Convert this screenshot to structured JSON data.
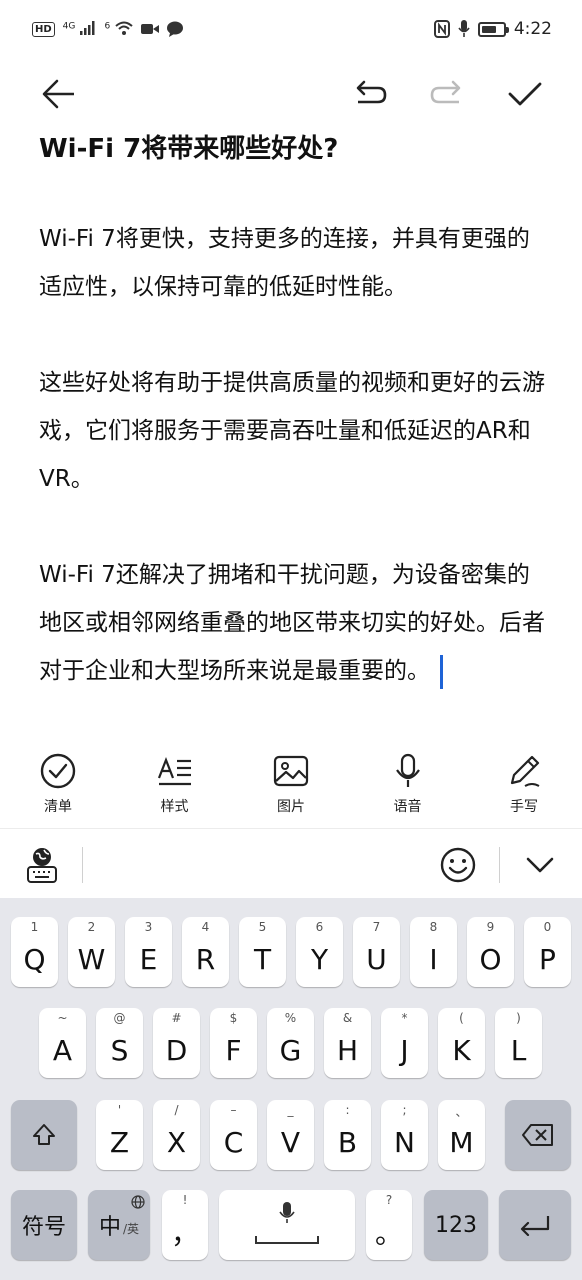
{
  "status_bar": {
    "hd": "HD",
    "sig1": "4G",
    "sig2": "6",
    "time": "4:22",
    "battery_level": 0.7
  },
  "toolbar": {
    "back_icon": "arrow-left-icon",
    "undo_icon": "undo-icon",
    "redo_icon": "redo-icon",
    "done_icon": "check-icon"
  },
  "note": {
    "title": "Wi-Fi 7将带来哪些好处?",
    "paragraphs": [
      "Wi-Fi 7将更快，支持更多的连接，并具有更强的适应性，以保持可靠的低延时性能。",
      "这些好处将有助于提供高质量的视频和更好的云游戏，它们将服务于需要高吞吐量和低延迟的AR和VR。",
      "Wi-Fi 7还解决了拥堵和干扰问题，为设备密集的地区或相邻网络重叠的地区带来切实的好处。后者对于企业和大型场所来说是最重要的。"
    ]
  },
  "format_bar": [
    {
      "label": "清单",
      "icon": "checklist-icon"
    },
    {
      "label": "样式",
      "icon": "text-style-icon"
    },
    {
      "label": "图片",
      "icon": "image-icon"
    },
    {
      "label": "语音",
      "icon": "microphone-icon"
    },
    {
      "label": "手写",
      "icon": "pen-icon"
    }
  ],
  "keyboard": {
    "row1": [
      {
        "hint": "1",
        "key": "Q"
      },
      {
        "hint": "2",
        "key": "W"
      },
      {
        "hint": "3",
        "key": "E"
      },
      {
        "hint": "4",
        "key": "R"
      },
      {
        "hint": "5",
        "key": "T"
      },
      {
        "hint": "6",
        "key": "Y"
      },
      {
        "hint": "7",
        "key": "U"
      },
      {
        "hint": "8",
        "key": "I"
      },
      {
        "hint": "9",
        "key": "O"
      },
      {
        "hint": "0",
        "key": "P"
      }
    ],
    "row2": [
      {
        "hint": "~",
        "key": "A"
      },
      {
        "hint": "@",
        "key": "S"
      },
      {
        "hint": "#",
        "key": "D"
      },
      {
        "hint": "$",
        "key": "F"
      },
      {
        "hint": "%",
        "key": "G"
      },
      {
        "hint": "&",
        "key": "H"
      },
      {
        "hint": "*",
        "key": "J"
      },
      {
        "hint": "(",
        "key": "K"
      },
      {
        "hint": ")",
        "key": "L"
      }
    ],
    "row3": [
      {
        "hint": "'",
        "key": "Z"
      },
      {
        "hint": "/",
        "key": "X"
      },
      {
        "hint": "–",
        "key": "C"
      },
      {
        "hint": "_",
        "key": "V"
      },
      {
        "hint": ":",
        "key": "B"
      },
      {
        "hint": ";",
        "key": "N"
      },
      {
        "hint": "、",
        "key": "M"
      }
    ],
    "symbols_label": "符号",
    "lang_main": "中",
    "lang_sub": "/英",
    "comma_hint": "!",
    "comma": "，",
    "period_hint": "?",
    "period": "。",
    "num_label": "123"
  }
}
